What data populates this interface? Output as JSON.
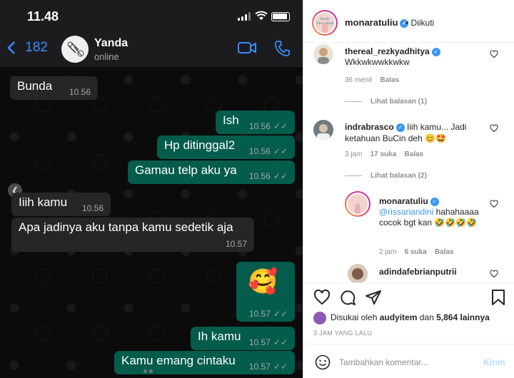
{
  "whatsapp": {
    "status_time": "11.48",
    "back_count": "182",
    "contact_name": "Yanda",
    "contact_status": "online",
    "messages": [
      {
        "dir": "in",
        "text": "Bunda",
        "time": "10.56"
      },
      {
        "dir": "out",
        "text": "Ish",
        "time": "10.56"
      },
      {
        "dir": "out",
        "text": "Hp ditinggal2",
        "time": "10.56"
      },
      {
        "dir": "out",
        "text": "Gamau telp aku ya",
        "time": "10.56"
      },
      {
        "dir": "in",
        "text": "Iiih kamu",
        "time": "10.56"
      },
      {
        "dir": "in",
        "text": "Apa jadinya aku tanpa kamu sedetik aja",
        "time": "10.57"
      },
      {
        "dir": "out",
        "text": "🥰",
        "time": "10.57"
      },
      {
        "dir": "out",
        "text": "Ih kamu",
        "time": "10.57"
      },
      {
        "dir": "out",
        "text": "Kamu emang cintaku",
        "time": "10.57"
      }
    ]
  },
  "instagram": {
    "header": {
      "username": "monaratuliu",
      "follow_status": "• Diikuti"
    },
    "comments": [
      {
        "user": "thereal_rezkyadhitya",
        "text": "Wkkwkwwkkwkw",
        "time": "36 menit",
        "likes": "",
        "reply": "Balas",
        "verified": true
      },
      {
        "view_replies": "Lihat balasan (1)"
      },
      {
        "user": "indrabrasco",
        "text": "Iiih kamu... Jadi ketahuan BuCin deh 😊🤩",
        "time": "3 jam",
        "likes": "17 suka",
        "reply": "Balas",
        "verified": true
      },
      {
        "view_replies": "Lihat balasan (2)"
      },
      {
        "user": "monaratuliu",
        "mention": "@rissariandini",
        "text": "hahahaaaa cocok bgt kan 🤣🤣🤣🤣",
        "time": "2 jam",
        "likes": "6 suka",
        "reply": "Balas",
        "verified": true
      },
      {
        "user": "adindafebrianputrii",
        "text": "",
        "verified": false
      }
    ],
    "likes_text_prefix": "Disukai oleh ",
    "likes_user": "audyitem",
    "likes_text_mid": " dan ",
    "likes_count": "5,864 lainnya",
    "time_ago": "3 JAM YANG LALU",
    "comment_placeholder": "Tambahkan komentar...",
    "send_label": "Kirim",
    "post_avatar_text": "Nody Shontkist"
  },
  "colors": {
    "wa_out": "#035c4c",
    "wa_in": "#262626",
    "ig_link": "#3897f0"
  }
}
